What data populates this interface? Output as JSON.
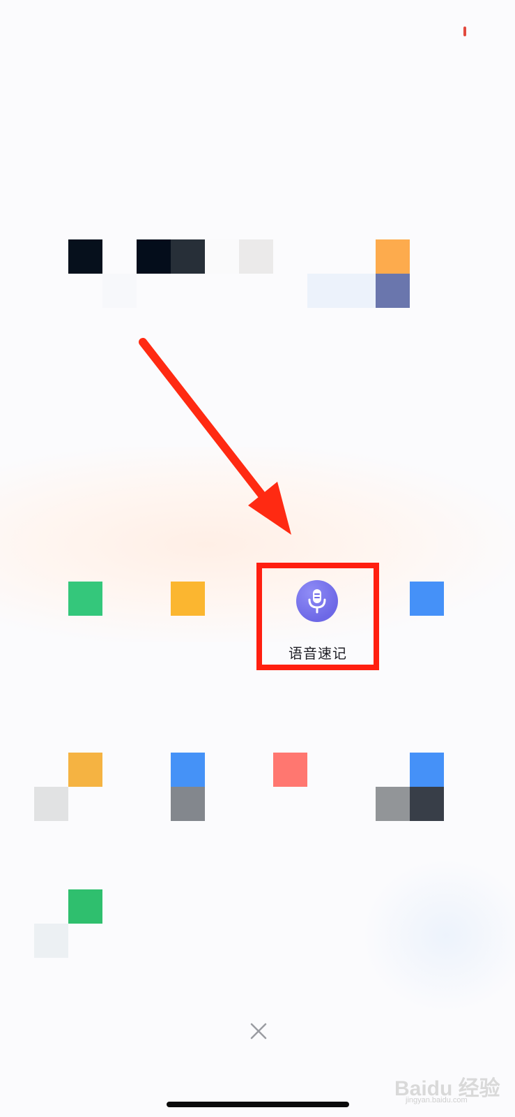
{
  "voice_note": {
    "label": "语音速记",
    "icon": "microphone-icon",
    "icon_color": "#6d68e6"
  },
  "annotation": {
    "arrow_color": "#ff2a12",
    "box_color": "#ff1f10"
  },
  "close": {
    "icon": "close-icon"
  },
  "watermark": {
    "text": "Baidu 经验",
    "sub": "jingyan.baidu.com"
  },
  "colors": {
    "status_indicator": "#e24a3e",
    "green": "#34c77b",
    "yellow": "#fbb630",
    "blue": "#4591f8",
    "coral": "#ff7770",
    "orange": "#fdab4d",
    "indigo": "#6a76ad"
  }
}
